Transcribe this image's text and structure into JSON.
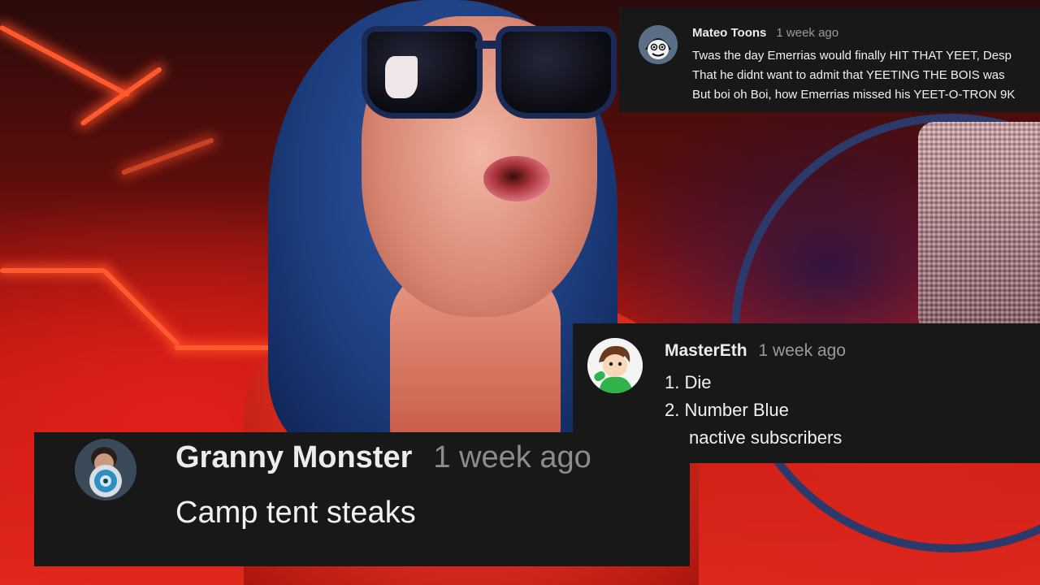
{
  "comments": [
    {
      "author": "Mateo Toons",
      "time": "1 week ago",
      "lines": [
        "Twas the day Emerrias would finally HIT THAT YEET, Desp",
        "That he didnt want to admit that YEETING THE BOIS was",
        "But boi oh Boi, how Emerrias missed his YEET-O-TRON 9K"
      ]
    },
    {
      "author": "MasterEth",
      "time": "1 week ago",
      "lines": [
        "1. Die",
        "2. Number Blue",
        "nactive subscribers"
      ]
    },
    {
      "author": "Granny Monster",
      "time": "1 week ago",
      "lines": [
        "Camp tent steaks"
      ]
    }
  ],
  "colors": {
    "panel": "#181818",
    "accent_red": "#e12a1c",
    "neon": "#ff5a2e"
  },
  "icons": [
    "cartoon-face-avatar-icon",
    "cartoon-boy-avatar-icon",
    "profile-photo-avatar-icon"
  ]
}
